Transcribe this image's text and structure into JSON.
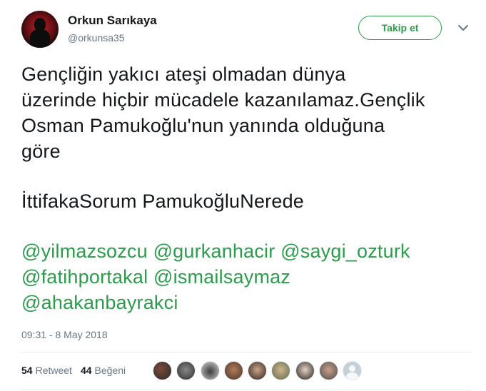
{
  "user": {
    "name": "Orkun Sarıkaya",
    "handle": "@orkunsa35",
    "follow_label": "Takip et"
  },
  "tweet": {
    "lines": [
      "Gençliğin yakıcı ateşi olmadan dünya",
      "üzerinde hiçbir mücadele kazanılamaz.Gençlik",
      "Osman Pamukoğlu'nun yanında olduğuna",
      "göre",
      "İttifakaSorum PamukoğluNerede"
    ],
    "mentions": [
      "@yilmazsozcu",
      "@gurkanhacir",
      "@saygi_ozturk",
      "@fatihportakal",
      "@ismailsaymaz",
      "@ahakanbayrakci"
    ],
    "timestamp": "09:31 - 8 May 2018"
  },
  "stats": {
    "retweets_count": "54",
    "retweets_label": "Retweet",
    "likes_count": "44",
    "likes_label": "Beğeni"
  },
  "colors": {
    "accent": "#2a9d4b",
    "secondary_text": "#657786",
    "divider": "#e6ecf0"
  },
  "liker_avatars": [
    "avatar-1",
    "avatar-2",
    "avatar-3",
    "avatar-4",
    "avatar-5",
    "avatar-6",
    "avatar-7",
    "avatar-8",
    "avatar-default"
  ]
}
